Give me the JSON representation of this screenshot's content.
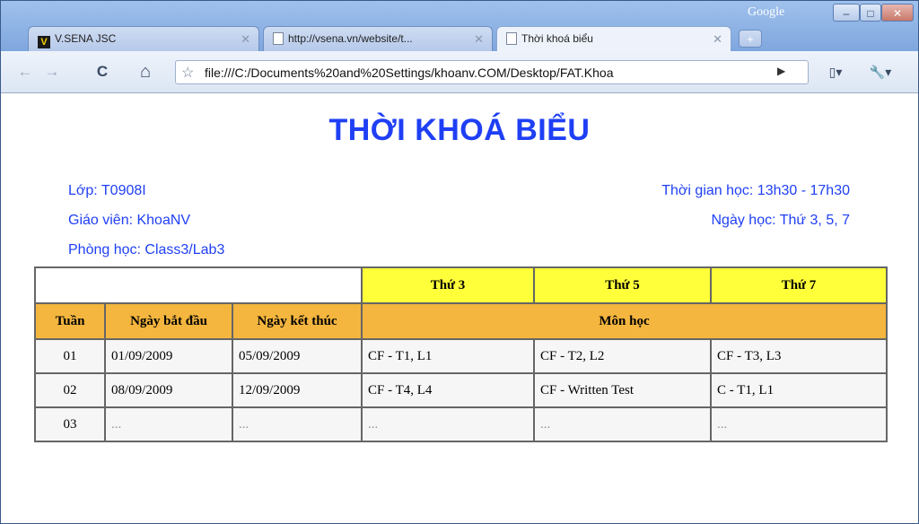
{
  "browser": {
    "brand_label": "Google",
    "tabs": [
      {
        "label": "V.SENA JSC",
        "icon": "vsena-favicon"
      },
      {
        "label": "http://vsena.vn/website/t...",
        "icon": "page-icon"
      },
      {
        "label": "Thời khoá biểu",
        "icon": "page-icon"
      }
    ],
    "new_tab_symbol": "+",
    "url": "file:///C:/Documents%20and%20Settings/khoanv.COM/Desktop/FAT.Khoa",
    "window_buttons": {
      "minimize": "–",
      "maximize": "□",
      "close": "✕"
    },
    "toolbar_icons": {
      "back": "←",
      "forward": "→",
      "reload": "C",
      "home": "⌂",
      "star": "☆",
      "go": "▶",
      "page_menu": "▯▾",
      "tools_menu": "🔧▾"
    }
  },
  "page": {
    "title": "THỜI KHOÁ BIỂU",
    "class_label": "Lớp: T0908I",
    "teacher_label": "Giáo viên: KhoaNV",
    "room_label": "Phòng học: Class3/Lab3",
    "time_label": "Thời gian học: 13h30 - 17h30",
    "days_label": "Ngày học: Thứ 3, 5, 7"
  },
  "schedule": {
    "day_headers": [
      "Thứ 3",
      "Thứ 5",
      "Thứ 7"
    ],
    "col_headers": {
      "week": "Tuần",
      "start": "Ngày bắt đầu",
      "end": "Ngày kết thúc",
      "subject": "Môn học"
    },
    "rows": [
      {
        "week": "01",
        "start": "01/09/2009",
        "end": "05/09/2009",
        "d3": "CF - T1, L1",
        "d5": "CF - T2, L2",
        "d7": "CF - T3, L3"
      },
      {
        "week": "02",
        "start": "08/09/2009",
        "end": "12/09/2009",
        "d3": "CF - T4, L4",
        "d5": "CF - Written Test",
        "d7": "C - T1, L1"
      },
      {
        "week": "03",
        "start": "...",
        "end": "...",
        "d3": "...",
        "d5": "...",
        "d7": "..."
      }
    ]
  },
  "colors": {
    "accent": "#1f3ff5",
    "day_header_bg": "#ffff3a",
    "col_header_bg": "#f4b63e"
  }
}
